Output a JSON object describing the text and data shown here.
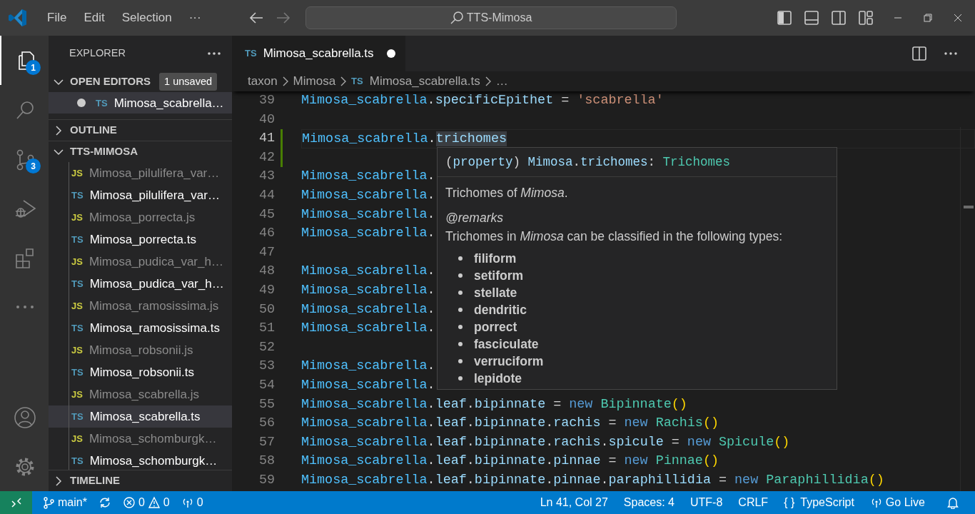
{
  "title_bar": {
    "menus": [
      {
        "label": "File"
      },
      {
        "label": "Edit"
      },
      {
        "label": "Selection"
      },
      {
        "label": "···"
      }
    ],
    "search": "TTS-Mimosa"
  },
  "activity_bar": [
    {
      "kind": "explorer",
      "selected": true,
      "badge": "1"
    },
    {
      "kind": "search",
      "selected": false
    },
    {
      "kind": "source-control",
      "selected": false,
      "badge": "3"
    },
    {
      "kind": "run-debug",
      "selected": false
    },
    {
      "kind": "extensions",
      "selected": false
    },
    {
      "kind": "more",
      "selected": false
    }
  ],
  "activity_bar_bottom": [
    {
      "kind": "accounts"
    },
    {
      "kind": "settings"
    }
  ],
  "sidebar": {
    "title": "EXPLORER",
    "open_editors": {
      "label": "OPEN EDITORS",
      "expanded": true,
      "badge": "1 unsaved",
      "items": [
        {
          "type_label": "TS",
          "name": "Mimosa_scabrella…",
          "dirty": true,
          "selected": true
        }
      ]
    },
    "outline": {
      "label": "OUTLINE",
      "expanded": false
    },
    "folder": {
      "label": "TTS-MIMOSA",
      "expanded": true,
      "files": [
        {
          "kind": "js",
          "type_label": "JS",
          "name": "Mimosa_pilulifera_var…",
          "selected": false
        },
        {
          "kind": "ts",
          "type_label": "TS",
          "name": "Mimosa_pilulifera_var…",
          "selected": false
        },
        {
          "kind": "js",
          "type_label": "JS",
          "name": "Mimosa_porrecta.js",
          "selected": false
        },
        {
          "kind": "ts",
          "type_label": "TS",
          "name": "Mimosa_porrecta.ts",
          "selected": false
        },
        {
          "kind": "js",
          "type_label": "JS",
          "name": "Mimosa_pudica_var_h…",
          "selected": false
        },
        {
          "kind": "ts",
          "type_label": "TS",
          "name": "Mimosa_pudica_var_h…",
          "selected": false
        },
        {
          "kind": "js",
          "type_label": "JS",
          "name": "Mimosa_ramosissima.js",
          "selected": false
        },
        {
          "kind": "ts",
          "type_label": "TS",
          "name": "Mimosa_ramosissima.ts",
          "selected": false
        },
        {
          "kind": "js",
          "type_label": "JS",
          "name": "Mimosa_robsonii.js",
          "selected": false
        },
        {
          "kind": "ts",
          "type_label": "TS",
          "name": "Mimosa_robsonii.ts",
          "selected": false
        },
        {
          "kind": "js",
          "type_label": "JS",
          "name": "Mimosa_scabrella.js",
          "selected": false
        },
        {
          "kind": "ts",
          "type_label": "TS",
          "name": "Mimosa_scabrella.ts",
          "selected": true
        },
        {
          "kind": "js",
          "type_label": "JS",
          "name": "Mimosa_schomburgk…",
          "selected": false
        },
        {
          "kind": "ts",
          "type_label": "TS",
          "name": "Mimosa_schomburgk…",
          "selected": false
        }
      ]
    },
    "timeline": {
      "label": "TIMELINE",
      "expanded": false
    }
  },
  "editor": {
    "tabs": [
      {
        "type_label": "TS",
        "name": "Mimosa_scabrella.ts",
        "dirty": true,
        "selected": true
      }
    ],
    "breadcrumbs": [
      {
        "label": "taxon"
      },
      {
        "label": "Mimosa"
      },
      {
        "label": "Mimosa_scabrella.ts",
        "type_label": "TS"
      },
      {
        "label": "…"
      }
    ],
    "lines": [
      {
        "number": "39",
        "current": false,
        "changed": false,
        "tokens": [
          {
            "kind": "object",
            "text": "Mimosa_scabrella"
          },
          {
            "kind": "punct",
            "text": "."
          },
          {
            "kind": "property",
            "text": "specificEpithet"
          },
          {
            "kind": "punct",
            "text": " = "
          },
          {
            "kind": "string",
            "text": "'scabrella'"
          }
        ]
      },
      {
        "number": "40",
        "current": false,
        "changed": false
      },
      {
        "number": "41",
        "current": true,
        "changed": true,
        "tokens": [
          {
            "kind": "object",
            "text": "Mimosa_scabrella"
          },
          {
            "kind": "punct",
            "text": "."
          },
          {
            "kind": "property",
            "text": "trichomes",
            "highlighted": true
          }
        ]
      },
      {
        "number": "42",
        "current": false,
        "changed": true
      },
      {
        "number": "43",
        "current": false,
        "changed": false,
        "tokens": [
          {
            "kind": "object",
            "text": "Mimosa_scabrella"
          },
          {
            "kind": "punct",
            "text": "."
          }
        ]
      },
      {
        "number": "44",
        "current": false,
        "changed": false,
        "tokens": [
          {
            "kind": "object",
            "text": "Mimosa_scabrella"
          },
          {
            "kind": "punct",
            "text": "."
          }
        ]
      },
      {
        "number": "45",
        "current": false,
        "changed": false,
        "tokens": [
          {
            "kind": "object",
            "text": "Mimosa_scabrella"
          },
          {
            "kind": "punct",
            "text": "."
          }
        ]
      },
      {
        "number": "46",
        "current": false,
        "changed": false,
        "tokens": [
          {
            "kind": "object",
            "text": "Mimosa_scabrella"
          },
          {
            "kind": "punct",
            "text": "."
          }
        ]
      },
      {
        "number": "47",
        "current": false,
        "changed": false
      },
      {
        "number": "48",
        "current": false,
        "changed": false,
        "tokens": [
          {
            "kind": "object",
            "text": "Mimosa_scabrella"
          },
          {
            "kind": "punct",
            "text": "."
          }
        ]
      },
      {
        "number": "49",
        "current": false,
        "changed": false,
        "tokens": [
          {
            "kind": "object",
            "text": "Mimosa_scabrella"
          },
          {
            "kind": "punct",
            "text": "."
          }
        ]
      },
      {
        "number": "50",
        "current": false,
        "changed": false,
        "tokens": [
          {
            "kind": "object",
            "text": "Mimosa_scabrella"
          },
          {
            "kind": "punct",
            "text": "."
          }
        ]
      },
      {
        "number": "51",
        "current": false,
        "changed": false,
        "tokens": [
          {
            "kind": "object",
            "text": "Mimosa_scabrella"
          },
          {
            "kind": "punct",
            "text": "."
          }
        ]
      },
      {
        "number": "52",
        "current": false,
        "changed": false
      },
      {
        "number": "53",
        "current": false,
        "changed": false,
        "tokens": [
          {
            "kind": "object",
            "text": "Mimosa_scabrella"
          },
          {
            "kind": "punct",
            "text": "."
          }
        ]
      },
      {
        "number": "54",
        "current": false,
        "changed": false,
        "tokens": [
          {
            "kind": "object",
            "text": "Mimosa_scabrella"
          },
          {
            "kind": "punct",
            "text": "."
          }
        ]
      },
      {
        "number": "55",
        "current": false,
        "changed": false,
        "tokens": [
          {
            "kind": "object",
            "text": "Mimosa_scabrella"
          },
          {
            "kind": "punct",
            "text": "."
          },
          {
            "kind": "property",
            "text": "leaf"
          },
          {
            "kind": "punct",
            "text": "."
          },
          {
            "kind": "property",
            "text": "bipinnate"
          },
          {
            "kind": "punct",
            "text": " = "
          },
          {
            "kind": "keyword",
            "text": "new"
          },
          {
            "kind": "class",
            "text": "Bipinnate"
          },
          {
            "kind": "paren",
            "text": "()"
          }
        ]
      },
      {
        "number": "56",
        "current": false,
        "changed": false,
        "tokens": [
          {
            "kind": "object",
            "text": "Mimosa_scabrella"
          },
          {
            "kind": "punct",
            "text": "."
          },
          {
            "kind": "property",
            "text": "leaf"
          },
          {
            "kind": "punct",
            "text": "."
          },
          {
            "kind": "property",
            "text": "bipinnate"
          },
          {
            "kind": "punct",
            "text": "."
          },
          {
            "kind": "property",
            "text": "rachis"
          },
          {
            "kind": "punct",
            "text": " = "
          },
          {
            "kind": "keyword",
            "text": "new"
          },
          {
            "kind": "class",
            "text": "Rachis"
          },
          {
            "kind": "paren",
            "text": "()"
          }
        ]
      },
      {
        "number": "57",
        "current": false,
        "changed": false,
        "tokens": [
          {
            "kind": "object",
            "text": "Mimosa_scabrella"
          },
          {
            "kind": "punct",
            "text": "."
          },
          {
            "kind": "property",
            "text": "leaf"
          },
          {
            "kind": "punct",
            "text": "."
          },
          {
            "kind": "property",
            "text": "bipinnate"
          },
          {
            "kind": "punct",
            "text": "."
          },
          {
            "kind": "property",
            "text": "rachis"
          },
          {
            "kind": "punct",
            "text": "."
          },
          {
            "kind": "property",
            "text": "spicule"
          },
          {
            "kind": "punct",
            "text": " = "
          },
          {
            "kind": "keyword",
            "text": "new"
          },
          {
            "kind": "class",
            "text": "Spicule"
          },
          {
            "kind": "paren",
            "text": "()"
          }
        ]
      },
      {
        "number": "58",
        "current": false,
        "changed": false,
        "tokens": [
          {
            "kind": "object",
            "text": "Mimosa_scabrella"
          },
          {
            "kind": "punct",
            "text": "."
          },
          {
            "kind": "property",
            "text": "leaf"
          },
          {
            "kind": "punct",
            "text": "."
          },
          {
            "kind": "property",
            "text": "bipinnate"
          },
          {
            "kind": "punct",
            "text": "."
          },
          {
            "kind": "property",
            "text": "pinnae"
          },
          {
            "kind": "punct",
            "text": " = "
          },
          {
            "kind": "keyword",
            "text": "new"
          },
          {
            "kind": "class",
            "text": "Pinnae"
          },
          {
            "kind": "paren",
            "text": "()"
          }
        ]
      },
      {
        "number": "59",
        "current": false,
        "changed": false,
        "tokens": [
          {
            "kind": "object",
            "text": "Mimosa_scabrella"
          },
          {
            "kind": "punct",
            "text": "."
          },
          {
            "kind": "property",
            "text": "leaf"
          },
          {
            "kind": "punct",
            "text": "."
          },
          {
            "kind": "property",
            "text": "bipinnate"
          },
          {
            "kind": "punct",
            "text": "."
          },
          {
            "kind": "property",
            "text": "pinnae"
          },
          {
            "kind": "punct",
            "text": "."
          },
          {
            "kind": "property",
            "text": "paraphillidia"
          },
          {
            "kind": "punct",
            "text": " = "
          },
          {
            "kind": "keyword",
            "text": "new"
          },
          {
            "kind": "class",
            "text": "Paraphillidia"
          },
          {
            "kind": "paren",
            "text": "()"
          }
        ]
      }
    ],
    "hover": {
      "signature": [
        {
          "kind": "punct",
          "text": "("
        },
        {
          "kind": "property",
          "text": "property"
        },
        {
          "kind": "punct",
          "text": ") "
        },
        {
          "kind": "property",
          "text": "Mimosa"
        },
        {
          "kind": "punct",
          "text": "."
        },
        {
          "kind": "property",
          "text": "trichomes"
        },
        {
          "kind": "punct",
          "text": ": "
        },
        {
          "kind": "class",
          "text": "Trichomes"
        }
      ],
      "description": "Trichomes of *Mimosa*.",
      "tag": "@remarks",
      "remarks": "Trichomes in *Mimosa* can be classified in the following types:",
      "types": [
        "filiform",
        "setiform",
        "stellate",
        "dendritic",
        "porrect",
        "fasciculate",
        "verruciform",
        "lepidote"
      ]
    }
  },
  "status_bar": {
    "branch": "main*",
    "errors": "0",
    "warnings": "0",
    "ports": "0",
    "position": "Ln 41, Col 27",
    "indent": "Spaces: 4",
    "encoding": "UTF-8",
    "eol": "CRLF",
    "language_icon": "{ }",
    "language": "TypeScript",
    "go_live": "Go Live"
  }
}
